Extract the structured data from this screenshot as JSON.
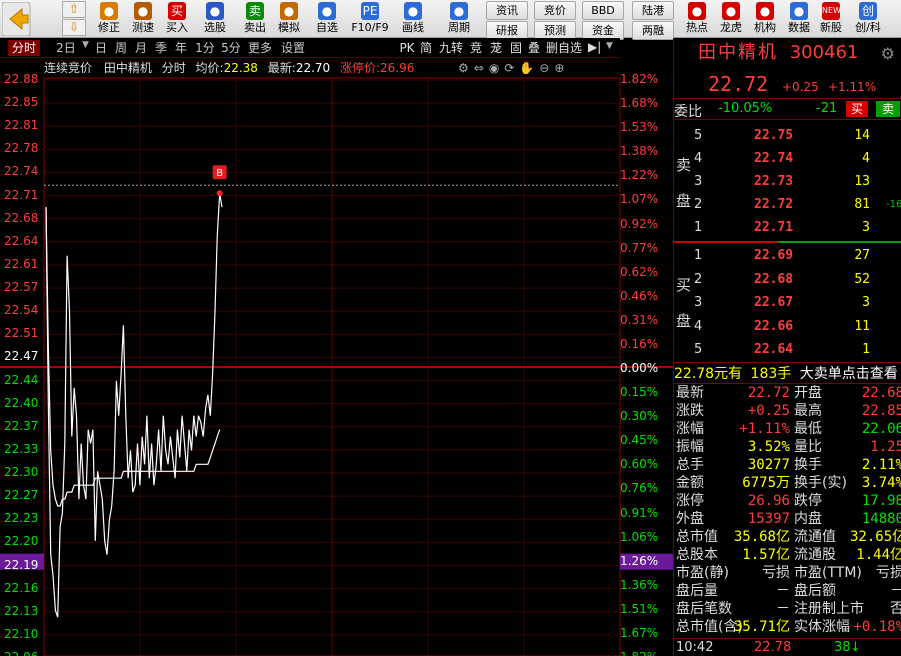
{
  "toolbar": {
    "nav_up": "⇧",
    "nav_down": "⇩",
    "buttons": [
      {
        "label": "修正",
        "icon": "refresh-icon",
        "color": "#d77c00"
      },
      {
        "label": "测速",
        "icon": "clock-icon",
        "color": "#b35c00"
      },
      {
        "label": "买入",
        "icon": "buy-icon",
        "glyph": "买",
        "color": "#d40000"
      },
      {
        "label": "选股",
        "icon": "select-icon",
        "color": "#2a58c8"
      },
      {
        "label": "卖出",
        "icon": "sell-icon",
        "glyph": "卖",
        "color": "#0a8a0a"
      },
      {
        "label": "模拟",
        "icon": "gavel-icon",
        "color": "#c26a00"
      },
      {
        "label": "自选",
        "icon": "star-icon",
        "color": "#2d6bd6"
      },
      {
        "label": "F10/F9",
        "icon": "pe-icon",
        "glyph": "PE",
        "color": "#2d6bd6"
      },
      {
        "label": "画线",
        "icon": "pen-icon",
        "color": "#2d6bd6"
      },
      {
        "label": "周期",
        "icon": "clock-icon",
        "color": "#2d6bd6"
      }
    ],
    "pairs": [
      {
        "top": "资讯",
        "bottom": "研报"
      },
      {
        "top": "竞价",
        "bottom": "预测"
      },
      {
        "top": "BBD",
        "bottom": "资金"
      },
      {
        "top": "陆港",
        "bottom": "两融"
      }
    ],
    "right_buttons": [
      {
        "label": "热点",
        "icon": "fire-icon",
        "color": "#d40000"
      },
      {
        "label": "龙虎",
        "icon": "tiger-icon",
        "color": "#d40000"
      },
      {
        "label": "机构",
        "icon": "building-icon",
        "color": "#d40000"
      },
      {
        "label": "数据",
        "icon": "chart-icon",
        "color": "#2d6bd6"
      },
      {
        "label": "新股",
        "icon": "new-icon",
        "glyph": "NEW",
        "color": "#d40000"
      },
      {
        "label": "创/科",
        "icon": "chuang-icon",
        "glyph": "创",
        "color": "#2d6bd6"
      }
    ]
  },
  "tabs": [
    "分时",
    "2日",
    "日",
    "周",
    "月",
    "季",
    "年",
    "1分",
    "5分",
    "更多",
    "设置"
  ],
  "tabs_right": [
    "PK",
    "简",
    "九转",
    "竞",
    "茏",
    "固",
    "叠",
    "删自选"
  ],
  "chart_header": {
    "auction": "连续竞价",
    "stock": "田中精机",
    "period": "分时",
    "avg_label": "均价:",
    "avg_value": "22.38",
    "latest_label": "最新:",
    "latest_value": "22.70",
    "limit_label": "涨停价:",
    "limit_value": "26.96"
  },
  "buy_marker": "B",
  "chart_data": {
    "type": "line",
    "yaxis_left": [
      "22.88",
      "22.85",
      "22.81",
      "22.78",
      "22.74",
      "22.71",
      "22.68",
      "22.64",
      "22.61",
      "22.57",
      "22.54",
      "22.51",
      "22.47",
      "22.44",
      "22.40",
      "22.37",
      "22.33",
      "22.30",
      "22.27",
      "22.23",
      "22.20",
      "22.19",
      "22.16",
      "22.13",
      "22.10",
      "22.06"
    ],
    "yaxis_right": [
      "1.82%",
      "1.68%",
      "1.53%",
      "1.38%",
      "1.22%",
      "1.07%",
      "0.92%",
      "0.77%",
      "0.62%",
      "0.46%",
      "0.31%",
      "0.16%",
      "0.00%",
      "0.15%",
      "0.30%",
      "0.45%",
      "0.60%",
      "0.76%",
      "0.91%",
      "1.06%",
      "1.26%",
      "1.36%",
      "1.51%",
      "1.67%",
      "1.82%"
    ],
    "prev_close": 22.47,
    "ylim": [
      22.06,
      22.88
    ],
    "highlight_left": "22.19",
    "highlight_right": "1.26%",
    "price_series": [
      22.7,
      22.42,
      22.2,
      22.17,
      22.12,
      22.11,
      22.24,
      22.26,
      22.36,
      22.63,
      22.55,
      22.37,
      22.44,
      22.4,
      22.28,
      22.36,
      22.3,
      22.28,
      22.38,
      22.36,
      22.38,
      22.22,
      22.32,
      22.3,
      22.28,
      22.22,
      22.2,
      22.25,
      22.27,
      22.32,
      22.45,
      22.4,
      22.46,
      22.53,
      22.4,
      22.31,
      22.35,
      22.29,
      22.3,
      22.36,
      22.3,
      22.37,
      22.33,
      22.4,
      22.31,
      22.36,
      22.3,
      22.33,
      22.38,
      22.32,
      22.4,
      22.35,
      22.33,
      22.37,
      22.34,
      22.31,
      22.38,
      22.34,
      22.4,
      22.36,
      22.32,
      22.38,
      22.35,
      22.4,
      22.37,
      22.4,
      22.39,
      22.37,
      22.41,
      22.43,
      22.4,
      22.46,
      22.55,
      22.66,
      22.72,
      22.7
    ],
    "avg_series": [
      22.7,
      22.5,
      22.35,
      22.3,
      22.28,
      22.27,
      22.27,
      22.28,
      22.28,
      22.29,
      22.29,
      22.29,
      22.3,
      22.3,
      22.3,
      22.3,
      22.3,
      22.3,
      22.3,
      22.3,
      22.3,
      22.31,
      22.31,
      22.31,
      22.31,
      22.31,
      22.31,
      22.31,
      22.31,
      22.31,
      22.31,
      22.31,
      22.31,
      22.32,
      22.32,
      22.32,
      22.32,
      22.32,
      22.32,
      22.32,
      22.32,
      22.32,
      22.32,
      22.32,
      22.32,
      22.32,
      22.32,
      22.32,
      22.32,
      22.32,
      22.32,
      22.32,
      22.32,
      22.32,
      22.32,
      22.32,
      22.32,
      22.32,
      22.32,
      22.32,
      22.32,
      22.32,
      22.32,
      22.32,
      22.33,
      22.33,
      22.33,
      22.33,
      22.33,
      22.33,
      22.34,
      22.35,
      22.36,
      22.37,
      22.38
    ],
    "grid": true
  },
  "panel": {
    "name": "田中精机",
    "code": "300461",
    "price": "22.72",
    "change": "+0.25",
    "change_pct": "+1.11%",
    "weibi_label": "委比",
    "weibi_value": "-10.05%",
    "weicha_value": "-21",
    "buy_btn": "买",
    "sell_btn": "卖",
    "sell_side": [
      "卖",
      "盘"
    ],
    "buy_side": [
      "买",
      "盘"
    ],
    "asks": [
      {
        "level": "5",
        "price": "22.75",
        "vol": "14",
        "extra": ""
      },
      {
        "level": "4",
        "price": "22.74",
        "vol": "4",
        "extra": ""
      },
      {
        "level": "3",
        "price": "22.73",
        "vol": "13",
        "extra": ""
      },
      {
        "level": "2",
        "price": "22.72",
        "vol": "81",
        "extra": "-16"
      },
      {
        "level": "1",
        "price": "22.71",
        "vol": "3",
        "extra": ""
      }
    ],
    "bids": [
      {
        "level": "1",
        "price": "22.69",
        "vol": "27"
      },
      {
        "level": "2",
        "price": "22.68",
        "vol": "52"
      },
      {
        "level": "3",
        "price": "22.67",
        "vol": "3"
      },
      {
        "level": "4",
        "price": "22.66",
        "vol": "11"
      },
      {
        "level": "5",
        "price": "22.64",
        "vol": "1"
      }
    ],
    "promo_price": "22.78元有",
    "promo_vol": "183手",
    "promo_text": "大卖单点击查看",
    "quotes": [
      {
        "l1": "最新",
        "v1": "22.72",
        "c1": "#ff3c3c",
        "l2": "开盘",
        "v2": "22.68",
        "c2": "#ff3c3c"
      },
      {
        "l1": "涨跌",
        "v1": "+0.25",
        "c1": "#ff3c3c",
        "l2": "最高",
        "v2": "22.85",
        "c2": "#ff3c3c"
      },
      {
        "l1": "涨幅",
        "v1": "+1.11%",
        "c1": "#ff3c3c",
        "l2": "最低",
        "v2": "22.06",
        "c2": "#00e000"
      },
      {
        "l1": "振幅",
        "v1": "3.52%",
        "c1": "#ffff00",
        "l2": "量比",
        "v2": "1.25",
        "c2": "#ff3c3c"
      },
      {
        "l1": "总手",
        "v1": "30277",
        "c1": "#ffff00",
        "l2": "换手",
        "v2": "2.11%",
        "c2": "#ffff00"
      },
      {
        "l1": "金额",
        "v1": "6775万",
        "c1": "#ffff00",
        "l2": "换手(实)",
        "v2": "3.74%",
        "c2": "#ffff00"
      },
      {
        "l1": "涨停",
        "v1": "26.96",
        "c1": "#ff3c3c",
        "l2": "跌停",
        "v2": "17.98",
        "c2": "#00e000"
      },
      {
        "l1": "外盘",
        "v1": "15397",
        "c1": "#ff3c3c",
        "l2": "内盘",
        "v2": "14880",
        "c2": "#00e000"
      },
      {
        "l1": "总市值",
        "v1": "35.68亿",
        "c1": "#ffff00",
        "l2": "流通值",
        "v2": "32.65亿",
        "c2": "#ffff00"
      },
      {
        "l1": "总股本",
        "v1": "1.57亿",
        "c1": "#ffff00",
        "l2": "流通股",
        "v2": "1.44亿",
        "c2": "#ffff00"
      },
      {
        "l1": "市盈(静)",
        "v1": "亏损",
        "c1": "#ddd",
        "l2": "市盈(TTM)",
        "v2": "亏损",
        "c2": "#ddd"
      },
      {
        "l1": "盘后量",
        "v1": "－",
        "c1": "#ddd",
        "l2": "盘后额",
        "v2": "－",
        "c2": "#ddd"
      },
      {
        "l1": "盘后笔数",
        "v1": "－",
        "c1": "#ddd",
        "l2": "注册制上市",
        "v2": "否",
        "c2": "#ddd"
      },
      {
        "l1": "总市值(含)",
        "v1": "35.71亿",
        "c1": "#ffff00",
        "l2": "实体涨幅",
        "v2": "+0.18%",
        "c2": "#ff3c3c"
      }
    ],
    "tick_time": "10:42",
    "tick_price": "22.78",
    "tick_vol": "38",
    "tick_dir": "↓"
  }
}
